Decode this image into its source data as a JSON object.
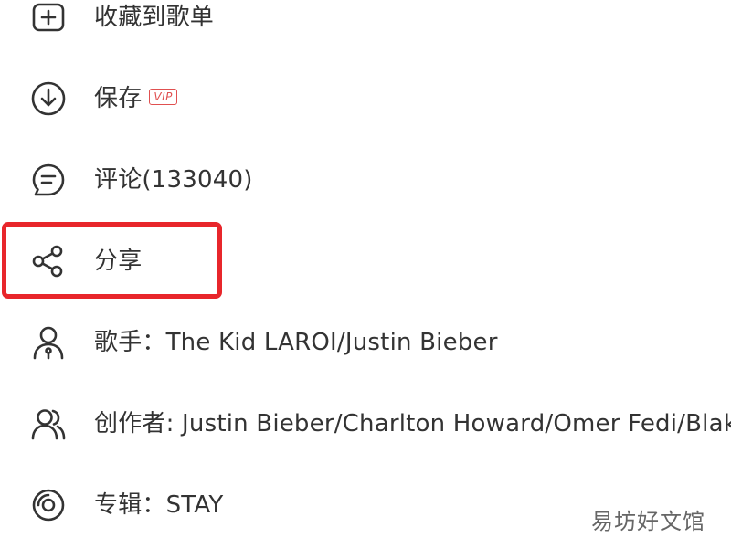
{
  "menu": {
    "items": [
      {
        "label": "收藏到歌单",
        "icon": "add-to-playlist-icon"
      },
      {
        "label": "保存",
        "icon": "download-icon",
        "badge": "VIP"
      },
      {
        "label": "评论(133040)",
        "icon": "comment-icon"
      },
      {
        "label": "分享",
        "icon": "share-icon"
      },
      {
        "label": "歌手：The Kid LAROI/Justin Bieber",
        "icon": "singer-icon"
      },
      {
        "label": "创作者: Justin Bieber/Charlton Howard/Omer Fedi/Blak…",
        "icon": "creators-icon"
      },
      {
        "label": "专辑：STAY",
        "icon": "album-icon"
      }
    ]
  },
  "highlight": {
    "color": "#e8262b"
  },
  "colors": {
    "text": "#333333",
    "icon_stroke": "#333333",
    "vip": "#e05050"
  },
  "watermark": {
    "text": "易坊好文馆"
  }
}
